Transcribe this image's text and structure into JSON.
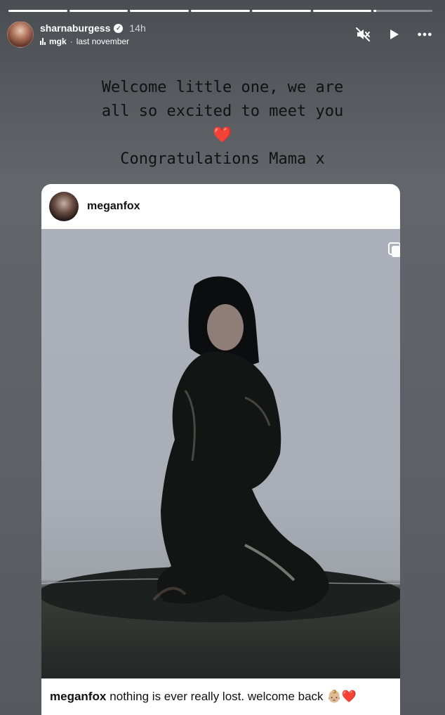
{
  "story": {
    "progress_segments": [
      1,
      1,
      1,
      1,
      1,
      1,
      0.05
    ],
    "user": {
      "username": "sharnaburgess",
      "verified": true,
      "time": "14h"
    },
    "music": {
      "artist": "mgk",
      "separator": "·",
      "title": "last november"
    },
    "actions": [
      "mute-icon",
      "play-icon",
      "more-icon"
    ],
    "caption_lines": [
      "Welcome little one, we are",
      "all so excited to meet you"
    ],
    "caption_heart": "❤️",
    "caption_last": "Congratulations Mama x"
  },
  "shared_post": {
    "username": "meganfox",
    "caption_user": "meganfox",
    "caption_text": "nothing is ever really lost. welcome back",
    "caption_emojis": "👶🏼❤️"
  },
  "colors": {
    "background": "#5e6267",
    "caption_text": "#111111",
    "card": "#ffffff"
  }
}
